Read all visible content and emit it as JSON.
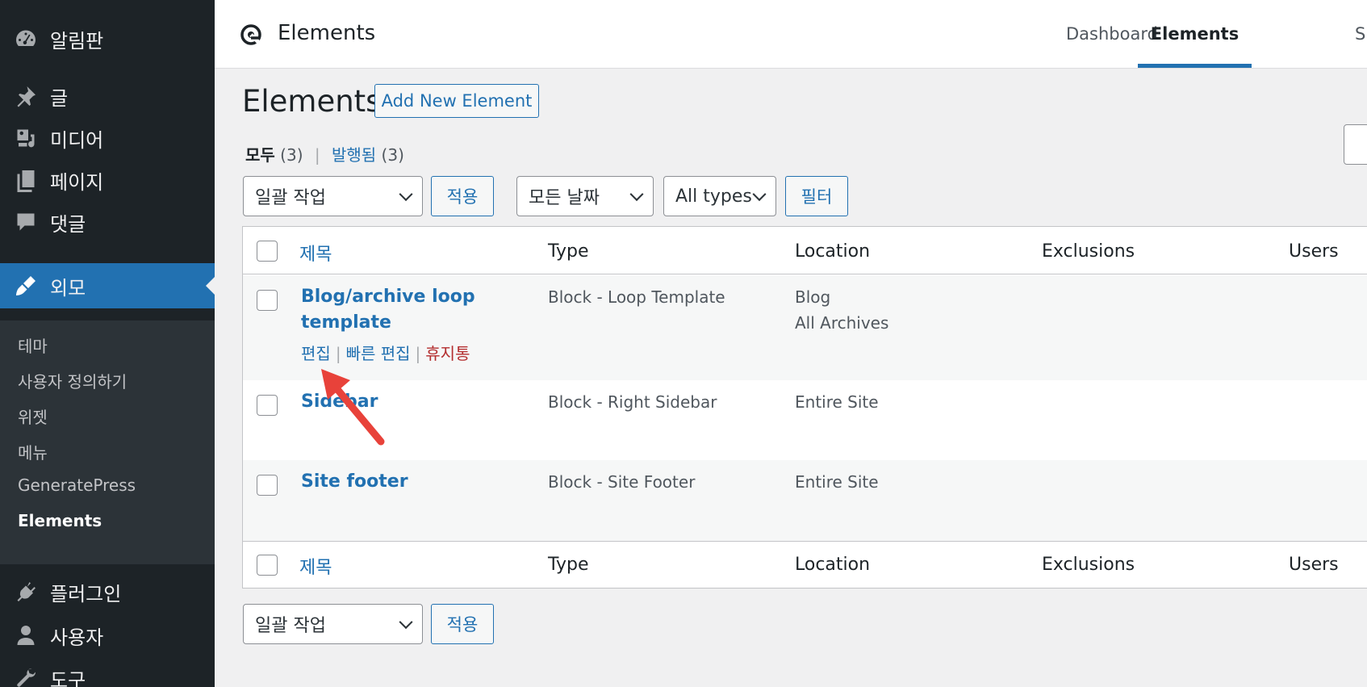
{
  "sidebar": {
    "items": [
      {
        "label": "알림판",
        "icon": "dashboard-icon"
      },
      {
        "label": "글",
        "icon": "pin-icon"
      },
      {
        "label": "미디어",
        "icon": "media-icon"
      },
      {
        "label": "페이지",
        "icon": "page-icon"
      },
      {
        "label": "댓글",
        "icon": "comment-icon"
      },
      {
        "label": "외모",
        "icon": "appearance-icon"
      },
      {
        "label": "플러그인",
        "icon": "plugin-icon"
      },
      {
        "label": "사용자",
        "icon": "user-icon"
      },
      {
        "label": "도구",
        "icon": "wrench-icon"
      }
    ],
    "submenu": [
      "테마",
      "사용자 정의하기",
      "위젯",
      "메뉴",
      "GeneratePress",
      "Elements"
    ]
  },
  "topbar": {
    "title": "Elements",
    "nav": [
      "Dashboard",
      "Elements",
      "S"
    ]
  },
  "page": {
    "title": "Elements",
    "add_new": "Add New Element"
  },
  "filters": {
    "all_label": "모두",
    "all_count": "(3)",
    "published_label": "발행됨",
    "published_count": "(3)",
    "bulk_action": "일괄 작업",
    "apply": "적용",
    "all_dates": "모든 날짜",
    "all_types": "All types",
    "filter": "필터"
  },
  "table": {
    "columns": [
      "제목",
      "Type",
      "Location",
      "Exclusions",
      "Users"
    ],
    "rows": [
      {
        "title_line1": "Blog/archive loop",
        "title_line2": "template",
        "type": "Block - Loop Template",
        "location_line1": "Blog",
        "location_line2": "All Archives"
      },
      {
        "title_line1": "Sidebar",
        "type": "Block - Right Sidebar",
        "location_line1": "Entire Site"
      },
      {
        "title_line1": "Site footer",
        "type": "Block - Site Footer",
        "location_line1": "Entire Site"
      }
    ],
    "row_actions": {
      "edit": "편집",
      "quick_edit": "빠른 편집",
      "trash": "휴지통",
      "separator": "|"
    }
  },
  "colors": {
    "accent": "#2271b1",
    "sidebar_bg": "#1d2327",
    "trash": "#b32d2e",
    "annotation_arrow": "#e8423a"
  }
}
